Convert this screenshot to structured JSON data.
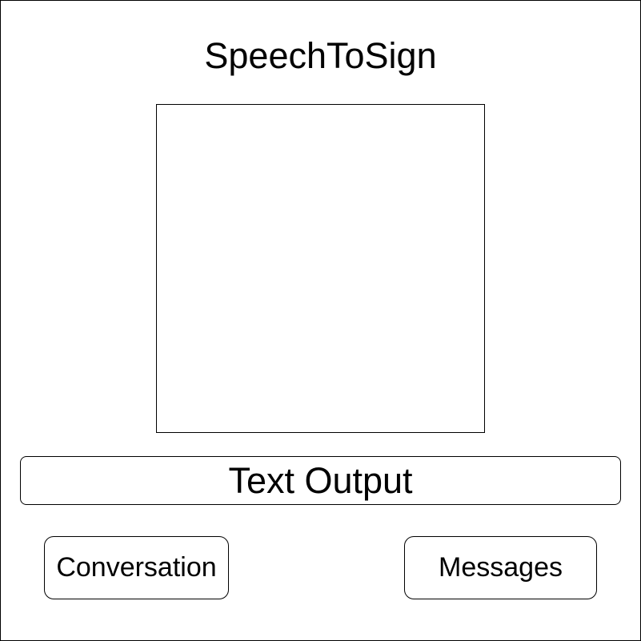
{
  "app": {
    "title": "SpeechToSign"
  },
  "main": {
    "text_output": "Text Output"
  },
  "nav": {
    "conversation_label": "Conversation",
    "messages_label": "Messages"
  }
}
